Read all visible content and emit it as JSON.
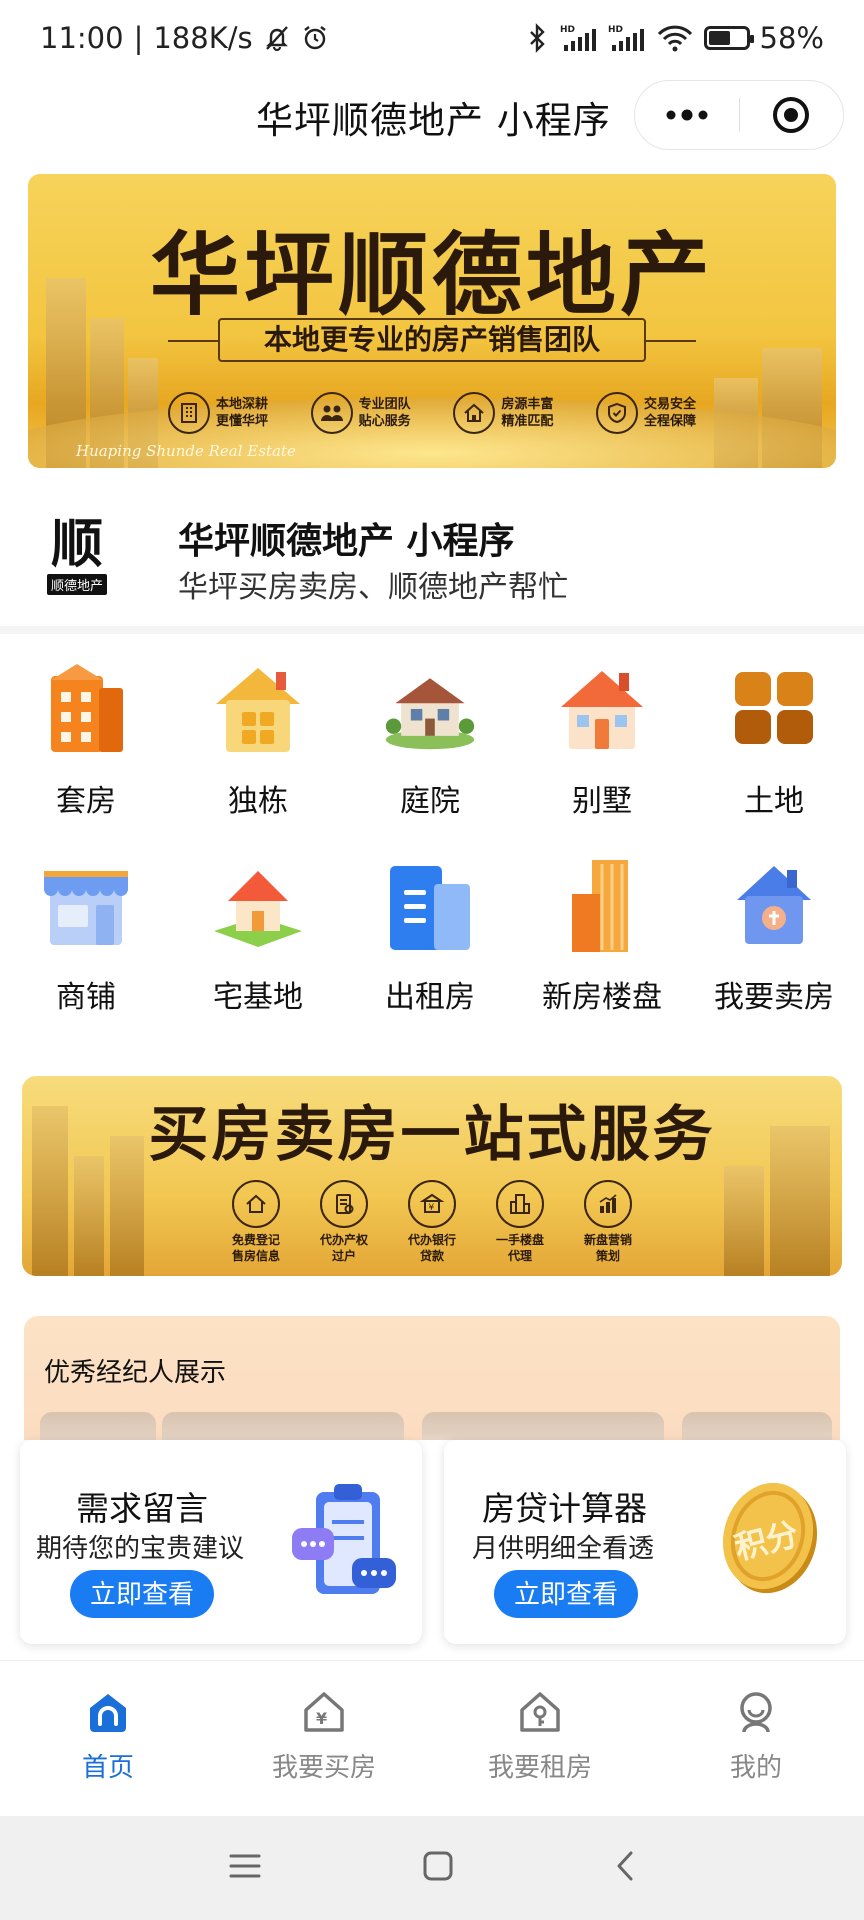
{
  "status_bar": {
    "time": "11:00",
    "net_speed": "188K/s",
    "battery": "58%",
    "battery_level": 0.58
  },
  "title_bar": {
    "title": "华坪顺德地产 小程序"
  },
  "banner1": {
    "headline": "华坪顺德地产",
    "subline": "本地更专业的房产销售团队",
    "features": [
      {
        "l1": "本地深耕",
        "l2": "更懂华坪",
        "icon": "building-icon"
      },
      {
        "l1": "专业团队",
        "l2": "贴心服务",
        "icon": "team-icon"
      },
      {
        "l1": "房源丰富",
        "l2": "精准匹配",
        "icon": "house-icon"
      },
      {
        "l1": "交易安全",
        "l2": "全程保障",
        "icon": "shield-icon"
      }
    ],
    "script": "Huaping Shunde Real Estate"
  },
  "app_info": {
    "logo_glyph": "顺",
    "logo_tag": "顺德地产",
    "name": "华坪顺德地产 小程序",
    "description": "华坪买房卖房、顺德地产帮忙"
  },
  "categories": [
    {
      "label": "套房",
      "icon": "apartment-icon",
      "color": "#f5841f"
    },
    {
      "label": "独栋",
      "icon": "single-house-icon",
      "color": "#f4c24c"
    },
    {
      "label": "庭院",
      "icon": "courtyard-icon",
      "color": "#c9a57a"
    },
    {
      "label": "别墅",
      "icon": "villa-icon",
      "color": "#f28a4a"
    },
    {
      "label": "土地",
      "icon": "land-icon",
      "color": "#c96f12"
    },
    {
      "label": "商铺",
      "icon": "shop-icon",
      "color": "#6d9cf0"
    },
    {
      "label": "宅基地",
      "icon": "homestead-icon",
      "color": "#f07a3a"
    },
    {
      "label": "出租房",
      "icon": "rental-icon",
      "color": "#2f7ef0"
    },
    {
      "label": "新房楼盘",
      "icon": "new-building-icon",
      "color": "#f29a2e"
    },
    {
      "label": "我要卖房",
      "icon": "sell-house-icon",
      "color": "#4b7de8"
    }
  ],
  "banner2": {
    "headline": "买房卖房一站式服务",
    "features": [
      {
        "l1": "免费登记",
        "l2": "售房信息",
        "icon": "home-outline-icon"
      },
      {
        "l1": "代办产权",
        "l2": "过户",
        "icon": "document-icon"
      },
      {
        "l1": "代办银行",
        "l2": "贷款",
        "icon": "bank-icon"
      },
      {
        "l1": "一手楼盘",
        "l2": "代理",
        "icon": "tower-icon"
      },
      {
        "l1": "新盘营销",
        "l2": "策划",
        "icon": "chart-icon"
      }
    ]
  },
  "agents": {
    "title": "优秀经纪人展示"
  },
  "cards": [
    {
      "title": "需求留言",
      "subtitle": "期待您的宝贵建议",
      "button": "立即查看",
      "icon": "message-board-icon"
    },
    {
      "title": "房贷计算器",
      "subtitle": "月供明细全看透",
      "button": "立即查看",
      "icon": "coin-icon",
      "coin_text": "积分"
    }
  ],
  "tabs": [
    {
      "label": "首页",
      "icon": "home-tab-icon",
      "active": true
    },
    {
      "label": "我要买房",
      "icon": "buy-house-icon",
      "active": false
    },
    {
      "label": "我要租房",
      "icon": "rent-house-icon",
      "active": false
    },
    {
      "label": "我的",
      "icon": "profile-icon",
      "active": false
    }
  ],
  "colors": {
    "accent": "#1a7cf3",
    "tab_active": "#1a6fd8",
    "tab_inactive": "#888888",
    "banner_gold": "#f3c540"
  }
}
